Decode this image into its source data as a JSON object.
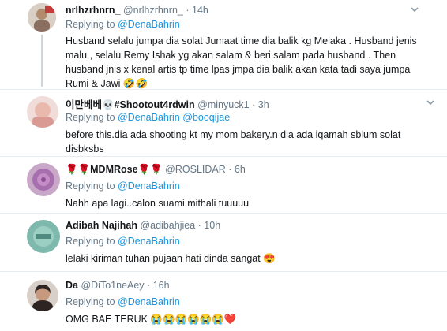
{
  "tweets": [
    {
      "name": "nrlhzrhnrn_",
      "handle": "@nrlhzrhnrn_",
      "time": "14h",
      "replying_label": "Replying to",
      "mentions": [
        "@DenaBahrin"
      ],
      "lines": [
        "Husband selalu jumpa dia solat Jumaat time dia balik kg Melaka . Husband jenis",
        "malu , selalu Remy Ishak yg akan salam & beri salam pada husband . Then",
        "husband jnis x kenal artis tp time lpas jmpa dia balik akan kata tadi saya jumpa",
        "Rumi & Jawi 🤣🤣"
      ],
      "avatar_color": "#c8b8a8"
    },
    {
      "name": "이만베베💀#Shootout4rdwin",
      "handle": "@minyuck1",
      "time": "3h",
      "replying_label": "Replying to",
      "mentions": [
        "@DenaBahrin",
        "@booqijae"
      ],
      "lines": [
        "before this.dia ada shooting kt my mom bakery.n dia ada iqamah sblum solat",
        "disbksbs"
      ],
      "avatar_color": "#e8c7c4"
    },
    {
      "name": "🌹🌹MDMRose🌹🌹",
      "handle": "@ROSLIDAR",
      "time": "6h",
      "replying_label": "Replying to",
      "mentions": [
        "@DenaBahrin"
      ],
      "lines": [
        "Nahh apa lagi..calon suami mithali tuuuuu"
      ],
      "avatar_color": "#b07ab0"
    },
    {
      "name": "Adibah Najihah",
      "handle": "@adibahjiea",
      "time": "10h",
      "replying_label": "Replying to",
      "mentions": [
        "@DenaBahrin"
      ],
      "lines": [
        "lelaki kiriman tuhan pujaan hati dinda sangat 😍"
      ],
      "avatar_color": "#6fa9a0"
    },
    {
      "name": "Da",
      "handle": "@DiTo1neAey",
      "time": "16h",
      "replying_label": "Replying to",
      "mentions": [
        "@DenaBahrin"
      ],
      "lines": [
        "OMG BAE TERUK 😭😭😭😭😭😭❤️"
      ],
      "avatar_color": "#3a2a26"
    }
  ],
  "dot_separator": "·",
  "chevron_icon": "chevron-down-icon"
}
